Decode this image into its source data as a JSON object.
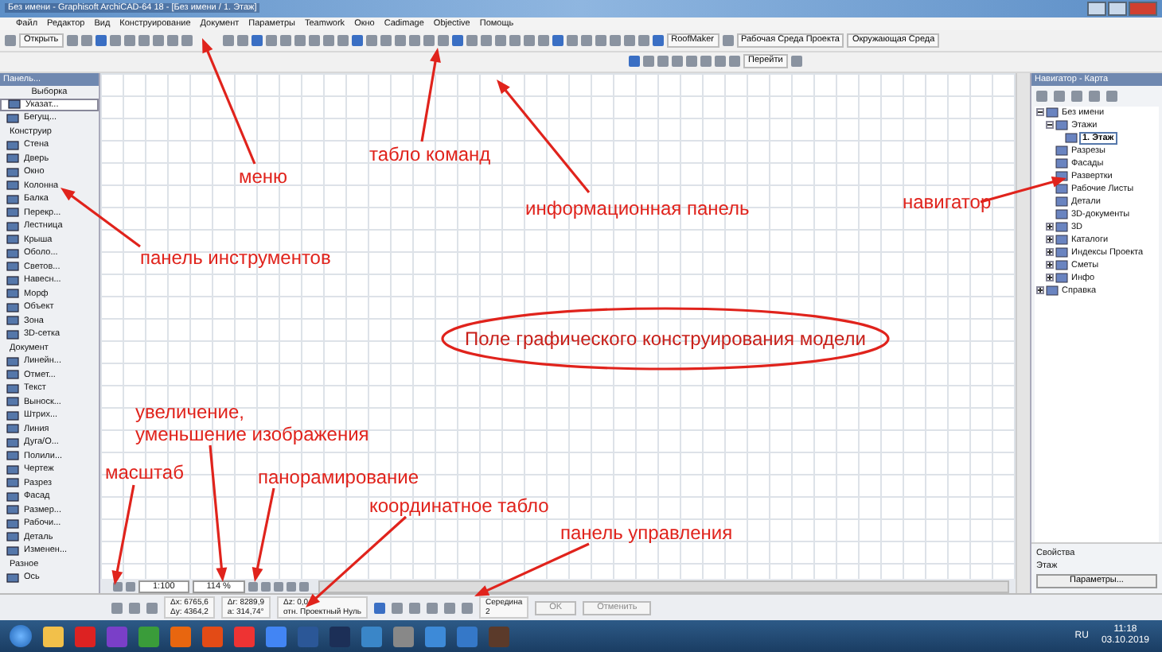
{
  "window": {
    "title": "Без имени - Graphisoft ArchiCAD-64 18 - [Без имени / 1. Этаж]"
  },
  "menu": [
    "Файл",
    "Редактор",
    "Вид",
    "Конструирование",
    "Документ",
    "Параметры",
    "Teamwork",
    "Окно",
    "Cadimage",
    "Objective",
    "Помощь"
  ],
  "toolbar": {
    "open_button": "Открыть",
    "roofmaker": "RoofMaker",
    "workspace": "Рабочая Среда Проекта",
    "environment": "Окружающая Среда",
    "goto_button": "Перейти"
  },
  "toolbox": {
    "title": "Панель...",
    "selection": "Выборка",
    "items": [
      {
        "label": "Указат...",
        "kind": "tool",
        "selected": true
      },
      {
        "label": "Бегущ...",
        "kind": "tool",
        "selected": false
      },
      {
        "label": "Конструир",
        "kind": "section"
      },
      {
        "label": "Стена",
        "kind": "tool",
        "selected": false
      },
      {
        "label": "Дверь",
        "kind": "tool",
        "selected": false
      },
      {
        "label": "Окно",
        "kind": "tool",
        "selected": false
      },
      {
        "label": "Колонна",
        "kind": "tool",
        "selected": false
      },
      {
        "label": "Балка",
        "kind": "tool",
        "selected": false
      },
      {
        "label": "Перекр...",
        "kind": "tool",
        "selected": false
      },
      {
        "label": "Лестница",
        "kind": "tool",
        "selected": false
      },
      {
        "label": "Крыша",
        "kind": "tool",
        "selected": false
      },
      {
        "label": "Оболо...",
        "kind": "tool",
        "selected": false
      },
      {
        "label": "Светов...",
        "kind": "tool",
        "selected": false
      },
      {
        "label": "Навесн...",
        "kind": "tool",
        "selected": false
      },
      {
        "label": "Морф",
        "kind": "tool",
        "selected": false
      },
      {
        "label": "Объект",
        "kind": "tool",
        "selected": false
      },
      {
        "label": "Зона",
        "kind": "tool",
        "selected": false
      },
      {
        "label": "3D-сетка",
        "kind": "tool",
        "selected": false
      },
      {
        "label": "Документ",
        "kind": "section"
      },
      {
        "label": "Линейн...",
        "kind": "tool",
        "selected": false
      },
      {
        "label": "Отмет...",
        "kind": "tool",
        "selected": false
      },
      {
        "label": "Текст",
        "kind": "tool",
        "selected": false
      },
      {
        "label": "Выноск...",
        "kind": "tool",
        "selected": false
      },
      {
        "label": "Штрих...",
        "kind": "tool",
        "selected": false
      },
      {
        "label": "Линия",
        "kind": "tool",
        "selected": false
      },
      {
        "label": "Дуга/О...",
        "kind": "tool",
        "selected": false
      },
      {
        "label": "Полили...",
        "kind": "tool",
        "selected": false
      },
      {
        "label": "Чертеж",
        "kind": "tool",
        "selected": false
      },
      {
        "label": "Разрез",
        "kind": "tool",
        "selected": false
      },
      {
        "label": "Фасад",
        "kind": "tool",
        "selected": false
      },
      {
        "label": "Размер...",
        "kind": "tool",
        "selected": false
      },
      {
        "label": "Рабочи...",
        "kind": "tool",
        "selected": false
      },
      {
        "label": "Деталь",
        "kind": "tool",
        "selected": false
      },
      {
        "label": "Изменен...",
        "kind": "tool",
        "selected": false
      },
      {
        "label": "Разное",
        "kind": "section"
      },
      {
        "label": "Ось",
        "kind": "tool",
        "selected": false
      }
    ]
  },
  "navigator": {
    "title": "Навигатор - Карта",
    "tree": [
      {
        "label": "Без имени",
        "expanded": true,
        "selected": false,
        "children": [
          {
            "label": "Этажи",
            "expanded": true,
            "selected": false,
            "children": [
              {
                "label": "1. Этаж",
                "selected": true
              }
            ]
          },
          {
            "label": "Разрезы",
            "selected": false
          },
          {
            "label": "Фасады",
            "selected": false
          },
          {
            "label": "Развертки",
            "selected": false
          },
          {
            "label": "Рабочие Листы",
            "selected": false
          },
          {
            "label": "Детали",
            "selected": false
          },
          {
            "label": "3D-документы",
            "selected": false
          },
          {
            "label": "3D",
            "expanded": false,
            "selected": false
          },
          {
            "label": "Каталоги",
            "expanded": false,
            "selected": false
          },
          {
            "label": "Индексы Проекта",
            "expanded": false,
            "selected": false
          },
          {
            "label": "Сметы",
            "expanded": false,
            "selected": false
          },
          {
            "label": "Инфо",
            "expanded": false,
            "selected": false
          }
        ]
      },
      {
        "label": "Справка",
        "expanded": false,
        "selected": false
      }
    ],
    "properties_label": "Свойства",
    "property_value": "Этаж",
    "settings_button": "Параметры..."
  },
  "view_bar": {
    "scale": "1:100",
    "zoom": "114 %"
  },
  "control_panel": {
    "coordinates": [
      [
        "Δx: 6765,6",
        "Δy: 4364,2"
      ],
      [
        "Δr: 8289,9",
        "a: 314,74°"
      ],
      [
        "Δz: 0,0",
        "отн. Проектный Нуль"
      ]
    ],
    "snap_label": "Середина",
    "snap_value": "2",
    "ok_button": "OK",
    "cancel_button": "Отменить"
  },
  "taskbar": {
    "language": "RU",
    "time": "11:18",
    "date": "03.10.2019"
  },
  "annotations": [
    {
      "text": "меню",
      "kind": "label"
    },
    {
      "text": "табло команд",
      "kind": "label"
    },
    {
      "text": "информационная панель",
      "kind": "label"
    },
    {
      "text": "навигатор",
      "kind": "label"
    },
    {
      "text": "панель инструментов",
      "kind": "label"
    },
    {
      "text": "Поле графического конструирования модели",
      "kind": "ellipse"
    },
    {
      "text": "увеличение,\nуменьшение изображения",
      "kind": "label"
    },
    {
      "text": "масштаб",
      "kind": "label"
    },
    {
      "text": "панорамирование",
      "kind": "label"
    },
    {
      "text": "координатное табло",
      "kind": "label"
    },
    {
      "text": "панель управления",
      "kind": "label"
    }
  ]
}
